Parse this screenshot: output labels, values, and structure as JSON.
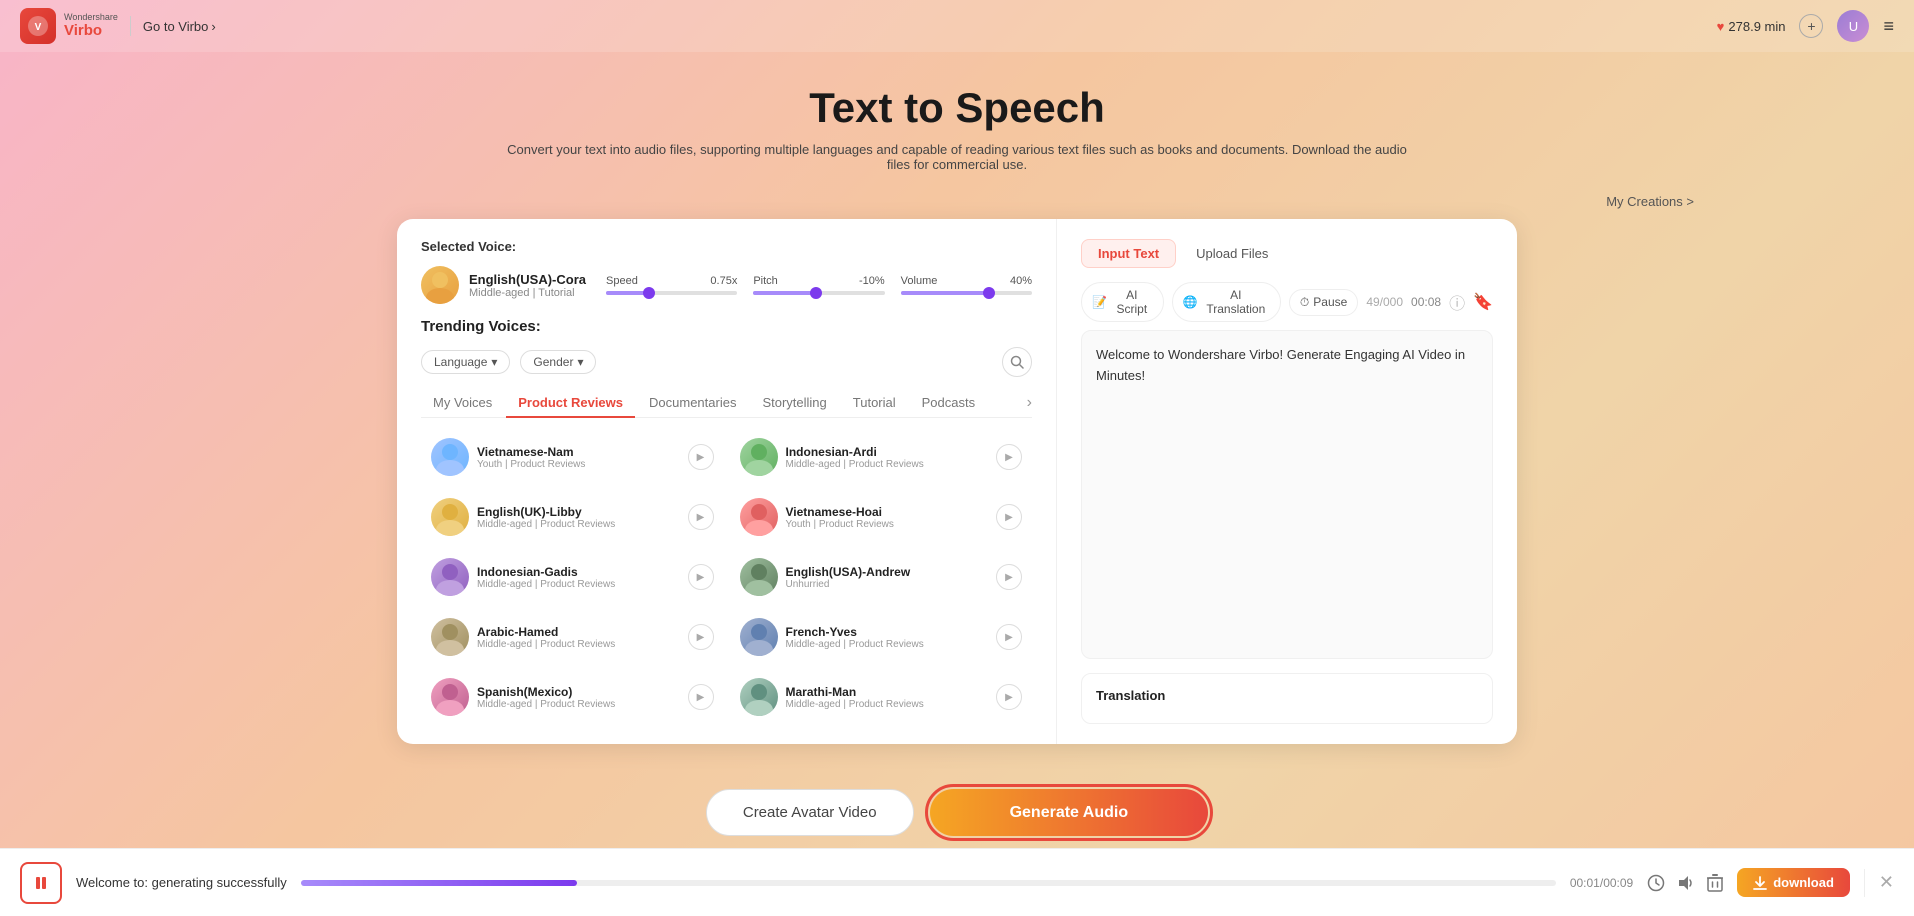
{
  "app": {
    "logo_brand": "Wondershare",
    "logo_name": "Virbo",
    "goto_label": "Go to Virbo",
    "minutes": "278.9 min",
    "page_title": "Text to Speech",
    "subtitle": "Convert your text into audio files, supporting multiple languages and capable of reading various text files such as books and documents. Download the audio files for commercial use.",
    "my_creations": "My Creations >"
  },
  "selected_voice": {
    "label": "Selected Voice:",
    "name": "English(USA)-Cora",
    "sub": "Middle-aged | Tutorial",
    "speed_label": "Speed",
    "speed_val": "0.75x",
    "pitch_label": "Pitch",
    "pitch_val": "-10%",
    "volume_label": "Volume",
    "volume_val": "40%"
  },
  "trending": {
    "label": "Trending Voices:",
    "language_placeholder": "Language",
    "gender_placeholder": "Gender",
    "tabs": [
      {
        "id": "my-voices",
        "label": "My Voices",
        "active": false
      },
      {
        "id": "product-reviews",
        "label": "Product Reviews",
        "active": true
      },
      {
        "id": "documentaries",
        "label": "Documentaries",
        "active": false
      },
      {
        "id": "storytelling",
        "label": "Storytelling",
        "active": false
      },
      {
        "id": "tutorial",
        "label": "Tutorial",
        "active": false
      },
      {
        "id": "podcasts",
        "label": "Podcasts",
        "active": false
      }
    ],
    "voices": [
      {
        "id": "vietnamese-nam",
        "name": "Vietnamese-Nam",
        "sub": "Youth | Product Reviews",
        "avatar_class": "av-vietnamese-nam",
        "emoji": "👦"
      },
      {
        "id": "indonesian-ardi",
        "name": "Indonesian-Ardi",
        "sub": "Middle-aged | Product Reviews",
        "avatar_class": "av-indonesian-ardi",
        "emoji": "👨"
      },
      {
        "id": "english-uk-libby",
        "name": "English(UK)-Libby",
        "sub": "Middle-aged | Product Reviews",
        "avatar_class": "av-english-uk-libby",
        "emoji": "👩"
      },
      {
        "id": "vietnamese-hoai",
        "name": "Vietnamese-Hoai",
        "sub": "Youth | Product Reviews",
        "avatar_class": "av-vietnamese-hoai",
        "emoji": "👧"
      },
      {
        "id": "indonesian-gadis",
        "name": "Indonesian-Gadis",
        "sub": "Middle-aged | Product Reviews",
        "avatar_class": "av-indonesian-gadis",
        "emoji": "👩"
      },
      {
        "id": "english-andrew",
        "name": "English(USA)-Andrew",
        "sub": "Unhurried",
        "avatar_class": "av-english-andrew",
        "emoji": "👨"
      },
      {
        "id": "arabic-hamed",
        "name": "Arabic-Hamed",
        "sub": "Middle-aged | Product Reviews",
        "avatar_class": "av-arabic-hamed",
        "emoji": "👳"
      },
      {
        "id": "french-yves",
        "name": "French-Yves",
        "sub": "Middle-aged | Product Reviews",
        "avatar_class": "av-french-yves",
        "emoji": "👨"
      },
      {
        "id": "spanish-mexico",
        "name": "Spanish(Mexico)",
        "sub": "Middle-aged | Product Reviews",
        "avatar_class": "av-spanish-mexico",
        "emoji": "👩"
      },
      {
        "id": "marathi-man",
        "name": "Marathi-Man",
        "sub": "Middle-aged | Product Reviews",
        "avatar_class": "av-marathi-man",
        "emoji": "👨"
      }
    ]
  },
  "right_panel": {
    "tab_input": "Input Text",
    "tab_upload": "Upload Files",
    "btn_ai_script": "AI Script",
    "btn_ai_translation": "AI Translation",
    "btn_pause": "Pause",
    "time": "00:08",
    "char_count": "49/000",
    "text_content": "Welcome to Wondershare Virbo! Generate Engaging AI Video in Minutes!",
    "translation_label": "Translation"
  },
  "bottom_actions": {
    "create_avatar": "Create Avatar Video",
    "generate_audio": "Generate Audio"
  },
  "player": {
    "status": "Welcome to: generating successfully",
    "time_current": "00:01",
    "time_total": "00:09",
    "download_label": "download"
  }
}
